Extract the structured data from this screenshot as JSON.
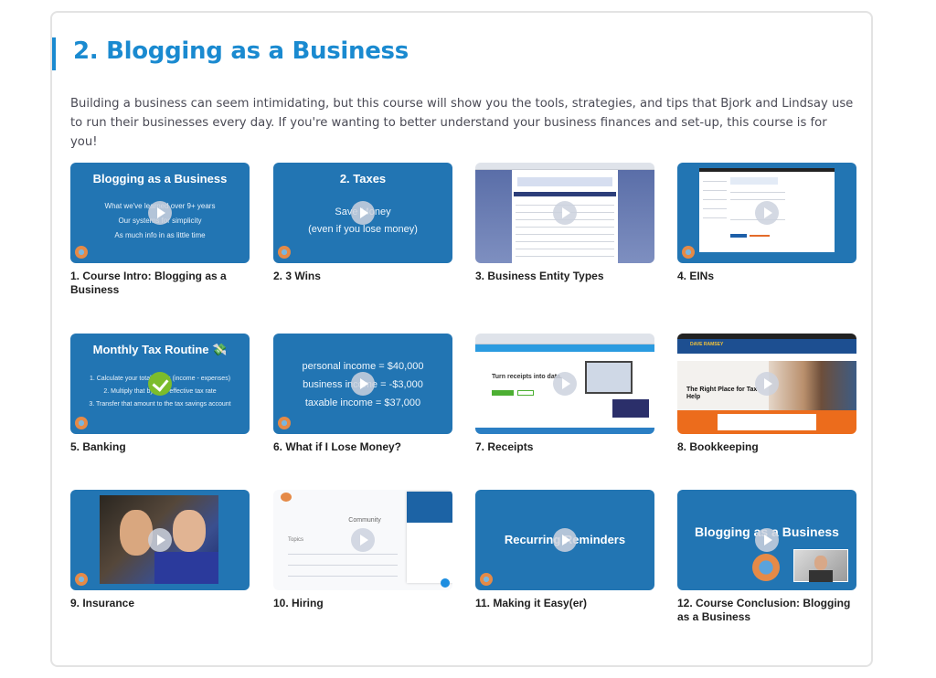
{
  "section": {
    "title": "2. Blogging as a Business",
    "description": "Building a business can seem intimidating, but this course will show you the tools, strategies, and tips that Bjork and Lindsay use to run their businesses every day. If you're wanting to better understand your business finances and set-up, this course is for you!",
    "accent_color": "#1a8ad0"
  },
  "lessons": [
    {
      "label": "1. Course Intro: Blogging as a Business",
      "status": "play-icon",
      "thumb": {
        "title": "Blogging as a Business",
        "lines": [
          "What we've learned over 9+ years",
          "Our systems for simplicity",
          "As much info in as little time"
        ]
      }
    },
    {
      "label": "2. 3 Wins",
      "status": "play-icon",
      "thumb": {
        "title": "2. Taxes",
        "lines": [
          "Save Money",
          "(even if you lose money)"
        ]
      }
    },
    {
      "label": "3. Business Entity Types",
      "status": "play-icon",
      "thumb": {
        "kind": "screenshot"
      }
    },
    {
      "label": "4. EINs",
      "status": "play-icon",
      "thumb": {
        "kind": "screenshot"
      }
    },
    {
      "label": "5. Banking",
      "status": "completed-check-icon",
      "thumb": {
        "title": "Monthly Tax Routine 💸",
        "lines": [
          "1.   Calculate your total profits (income - expenses)",
          "2.   Multiply that by your effective tax rate",
          "3.   Transfer that amount to the tax savings account"
        ]
      }
    },
    {
      "label": "6. What if I Lose Money?",
      "status": "play-icon",
      "thumb": {
        "lines": [
          "personal income = $40,000",
          "business income = -$3,000",
          "taxable income = $37,000"
        ]
      }
    },
    {
      "label": "7. Receipts",
      "status": "play-icon",
      "thumb": {
        "kind": "screenshot",
        "headline": "Turn receipts into data."
      }
    },
    {
      "label": "8. Bookkeeping",
      "status": "play-icon",
      "thumb": {
        "kind": "screenshot",
        "headline": "The Right Place for Tax Help",
        "brand": "DAVE RAMSEY"
      }
    },
    {
      "label": "9. Insurance",
      "status": "play-icon",
      "thumb": {
        "kind": "photo"
      }
    },
    {
      "label": "10. Hiring",
      "status": "play-icon",
      "thumb": {
        "kind": "screenshot",
        "headline": "Community",
        "subhead": "Topics"
      }
    },
    {
      "label": "11. Making it Easy(er)",
      "status": "play-icon",
      "thumb": {
        "title": "Recurring Reminders"
      }
    },
    {
      "label": "12. Course Conclusion: Blogging as a Business",
      "status": "play-icon",
      "thumb": {
        "title": "Blogging as a Business"
      }
    }
  ]
}
